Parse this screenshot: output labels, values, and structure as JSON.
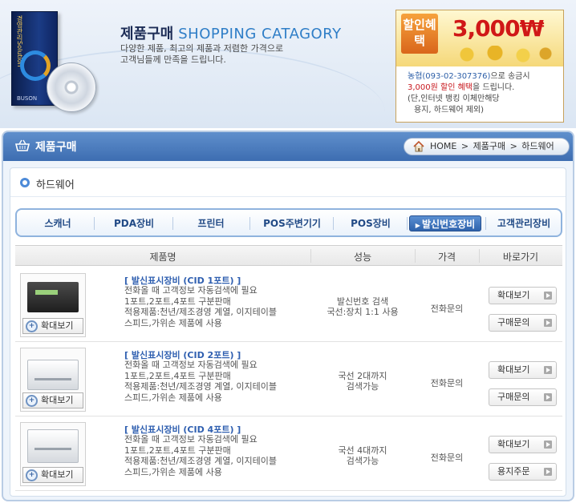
{
  "banner": {
    "title_kr": "제품구매",
    "title_en": "SHOPPING CATAGORY",
    "desc_line1": "다양한 제품, 최고의 제품과 저렴한 가격으로",
    "desc_line2": "고객님들께 만족을 드립니다.",
    "box_text": "경영관리Solution",
    "box_brand": "BUSON"
  },
  "promo": {
    "badge": "할인혜택",
    "amount": "3,000₩",
    "bank": "농협(093-02-307376)",
    "line1_rest": "으로 송금시",
    "line2_red": "3,000원 할인 혜택",
    "line2_rest": "을 드립니다.",
    "line3": "(단,인터넷 뱅킹 이체만해당",
    "line4": "용지, 하드웨어 제외)"
  },
  "header": {
    "title": "제품구매",
    "breadcrumb": [
      "HOME",
      ">",
      "제품구매",
      ">",
      "하드웨어"
    ]
  },
  "section": {
    "title": "하드웨어"
  },
  "tabs": [
    {
      "label": "스캐너",
      "active": false
    },
    {
      "label": "PDA장비",
      "active": false
    },
    {
      "label": "프린터",
      "active": false
    },
    {
      "label": "POS주변기기",
      "active": false
    },
    {
      "label": "POS장비",
      "active": false
    },
    {
      "label": "발신번호장비",
      "active": true
    },
    {
      "label": "고객관리장비",
      "active": false
    }
  ],
  "table": {
    "headers": [
      "제품명",
      "성능",
      "가격",
      "바로가기"
    ],
    "zoom_label": "확대보기",
    "rows": [
      {
        "name": "[ 발신표시장비 (CID 1포트) ]",
        "desc": [
          "전화올 때 고객정보 자동검색에 필요",
          "1포트,2포트,4포트 구분판매",
          "적용제품:천년/제조경영 계열, 이지테이블",
          "스피드,가위손 제품에 사용"
        ],
        "perf": [
          "발신번호 검색",
          "국선:장치 1:1 사용"
        ],
        "price": "전화문의",
        "btn1": "확대보기",
        "btn2": "구매문의"
      },
      {
        "name": "[ 발신표시장비 (CID 2포트) ]",
        "desc": [
          "전화올 때 고객정보 자동검색에 필요",
          "1포트,2포트,4포트 구분판매",
          "적용제품:천년/제조경영 계열, 이지테이블",
          "스피드,가위손 제품에 사용"
        ],
        "perf": [
          "국선 2대까지",
          "검색가능"
        ],
        "price": "전화문의",
        "btn1": "확대보기",
        "btn2": "구매문의"
      },
      {
        "name": "[ 발신표시장비 (CID 4포트) ]",
        "desc": [
          "전화올 때 고객정보 자동검색에 필요",
          "1포트,2포트,4포트 구분판매",
          "적용제품:천년/제조경영 계열, 이지테이블",
          "스피드,가위손 제품에 사용"
        ],
        "perf": [
          "국선 4대까지",
          "검색가능"
        ],
        "price": "전화문의",
        "btn1": "확대보기",
        "btn2": "용지주문"
      }
    ]
  }
}
